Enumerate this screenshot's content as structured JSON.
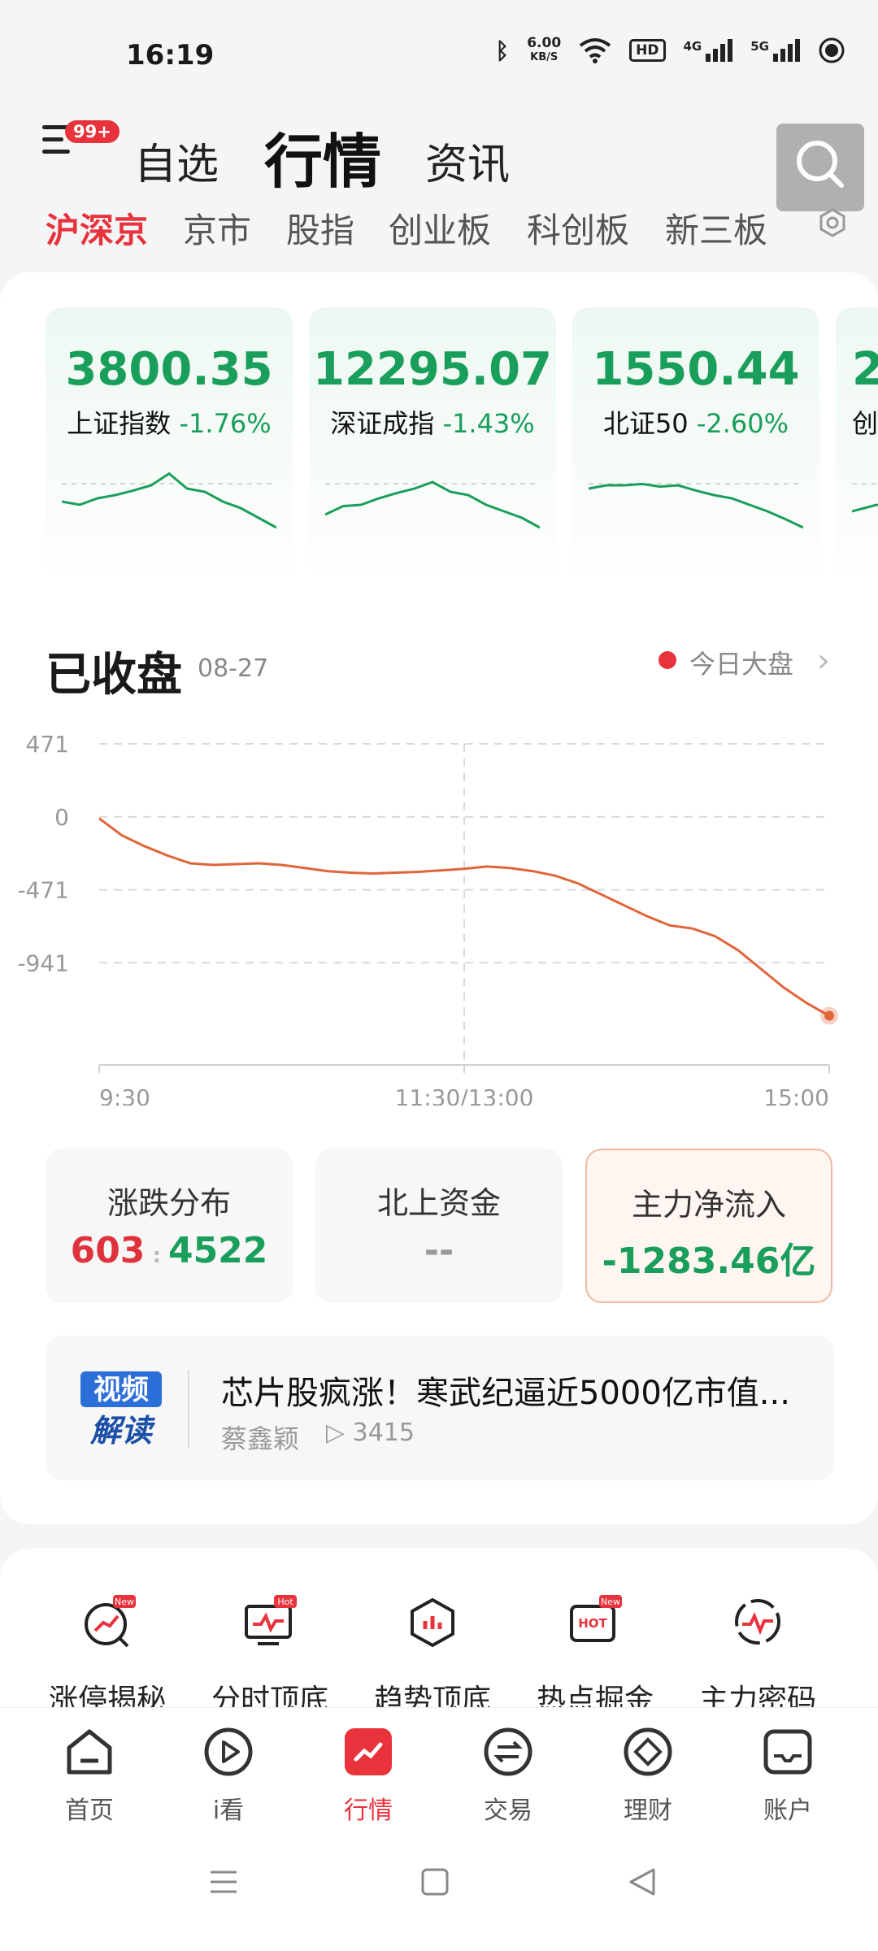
{
  "status": {
    "time": "16:19",
    "net_speed_top": "6.00",
    "net_speed_unit": "KB/S",
    "hd": "HD",
    "sig1": "4G",
    "sig2": "5G"
  },
  "header": {
    "notif_badge": "99+",
    "tabs": [
      "自选",
      "行情",
      "资讯"
    ]
  },
  "subtabs": [
    "沪深京",
    "京市",
    "股指",
    "创业板",
    "科创板",
    "新三板"
  ],
  "indices": [
    {
      "value": "3800.35",
      "name": "上证指数",
      "change": "-1.76%",
      "spark": [
        0.55,
        0.6,
        0.5,
        0.45,
        0.38,
        0.3,
        0.12,
        0.35,
        0.4,
        0.55,
        0.65,
        0.8,
        0.95
      ]
    },
    {
      "value": "12295.07",
      "name": "深证成指",
      "change": "-1.43%",
      "spark": [
        0.75,
        0.62,
        0.6,
        0.5,
        0.42,
        0.35,
        0.25,
        0.4,
        0.45,
        0.6,
        0.7,
        0.8,
        0.95
      ]
    },
    {
      "value": "1550.44",
      "name": "北证50",
      "change": "-2.60%",
      "spark": [
        0.35,
        0.3,
        0.3,
        0.28,
        0.32,
        0.3,
        0.38,
        0.45,
        0.5,
        0.6,
        0.7,
        0.82,
        0.95
      ]
    },
    {
      "value": "2",
      "name": "创",
      "change": "",
      "spark": [
        0.7,
        0.6,
        0.65
      ]
    }
  ],
  "market": {
    "title": "已收盘",
    "date": "08-27",
    "live_label": "今日大盘"
  },
  "chart_data": {
    "type": "line",
    "y_ticks": [
      "471",
      "0",
      "-471",
      "-941"
    ],
    "x_ticks": [
      "9:30",
      "11:30/13:00",
      "15:00"
    ],
    "ylim": [
      -1600,
      471
    ],
    "values": [
      -10,
      -120,
      -190,
      -250,
      -300,
      -310,
      -305,
      -300,
      -310,
      -330,
      -350,
      -360,
      -365,
      -360,
      -355,
      -345,
      -335,
      -320,
      -330,
      -350,
      -380,
      -430,
      -500,
      -570,
      -640,
      -700,
      -720,
      -770,
      -860,
      -980,
      -1100,
      -1200,
      -1283
    ]
  },
  "stats": [
    {
      "title": "涨跌分布",
      "up": "603",
      "down": "4522"
    },
    {
      "title": "北上资金",
      "value": "--"
    },
    {
      "title": "主力净流入",
      "value": "-1283.46亿"
    }
  ],
  "video": {
    "logo_top": "视频",
    "logo_bottom": "解读",
    "title": "芯片股疯涨！寒武纪逼近5000亿市值...",
    "author": "蔡鑫颖",
    "views": "3415"
  },
  "tools": [
    {
      "label": "涨停揭秘",
      "badge": "New"
    },
    {
      "label": "分时顶底",
      "badge": "Hot"
    },
    {
      "label": "趋势顶底",
      "badge": ""
    },
    {
      "label": "热点掘金",
      "badge": "New"
    },
    {
      "label": "主力密码",
      "badge": ""
    }
  ],
  "nav": [
    {
      "label": "首页",
      "icon": "home-icon"
    },
    {
      "label": "i看",
      "icon": "play-icon"
    },
    {
      "label": "行情",
      "icon": "market-icon"
    },
    {
      "label": "交易",
      "icon": "trade-icon"
    },
    {
      "label": "理财",
      "icon": "wealth-icon"
    },
    {
      "label": "账户",
      "icon": "account-icon"
    }
  ],
  "colors": {
    "red": "#e8323c",
    "green": "#1a9e5c",
    "line": "#e0653a"
  }
}
